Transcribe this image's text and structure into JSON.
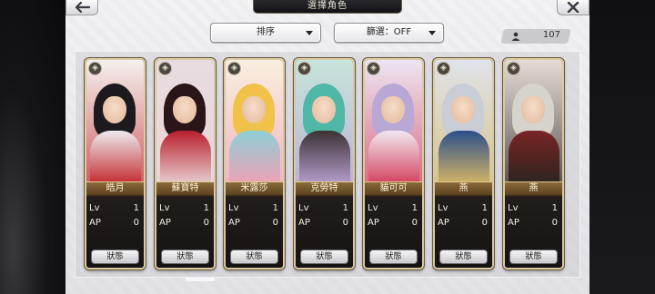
{
  "header": {
    "title": "選擇角色"
  },
  "toolbar": {
    "sort_label": "排序",
    "filter_label": "篩選：OFF",
    "owned_count": "107"
  },
  "stat_labels": {
    "level": "Lv",
    "ap": "AP",
    "status_button": "狀態"
  },
  "cards": [
    {
      "name": "皓月",
      "lv": "1",
      "ap": "0",
      "hair": "#1c1a1e",
      "outfit": "#ecebee",
      "accent": "#c4262c",
      "bg": "#f4f1ee"
    },
    {
      "name": "蘇寶特",
      "lv": "1",
      "ap": "0",
      "hair": "#2a1518",
      "outfit": "#b81f2c",
      "accent": "#e8d2d6",
      "bg": "#e8dce0"
    },
    {
      "name": "米露莎",
      "lv": "1",
      "ap": "0",
      "hair": "#f1c24a",
      "outfit": "#8ecfd6",
      "accent": "#f0a0b4",
      "bg": "#f8efe0"
    },
    {
      "name": "克勞特",
      "lv": "1",
      "ap": "0",
      "hair": "#4fb7a5",
      "outfit": "#3a3234",
      "accent": "#b9a0d0",
      "bg": "#c7e4dc"
    },
    {
      "name": "貓可可",
      "lv": "1",
      "ap": "0",
      "hair": "#b9a7d6",
      "outfit": "#f2e8f0",
      "accent": "#d23d5a",
      "bg": "#ede6f2"
    },
    {
      "name": "燕",
      "lv": "1",
      "ap": "0",
      "hair": "#c9cdd6",
      "outfit": "#2c4f8a",
      "accent": "#d8b766",
      "bg": "#dfe3ea"
    },
    {
      "name": "燕",
      "lv": "1",
      "ap": "0",
      "hair": "#d6d2cc",
      "outfit": "#7a2424",
      "accent": "#2a2420",
      "bg": "#e4dcd4"
    }
  ]
}
